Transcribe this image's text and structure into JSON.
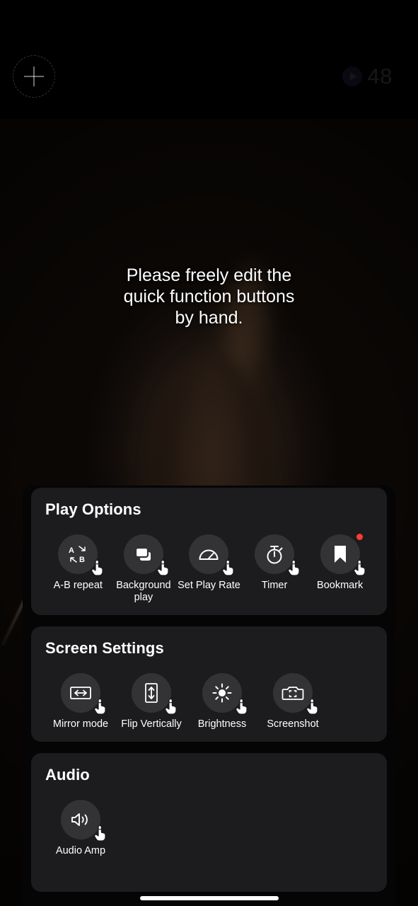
{
  "topbar": {
    "add_button_icon": "plus-icon",
    "play_count_icon": "play-circle-icon",
    "play_count": "48"
  },
  "hint": {
    "line1": "Please freely edit the",
    "line2": "quick function buttons",
    "line3": "by hand."
  },
  "colors": {
    "card_background": "#1c1c1e",
    "circle_background": "#333335",
    "badge_red": "#ff3b30",
    "text": "#ffffff"
  },
  "sections": [
    {
      "title": "Play Options",
      "buttons": [
        {
          "label": "A-B repeat",
          "icon": "ab-repeat-icon",
          "badge": false
        },
        {
          "label": "Background play",
          "icon": "background-play-icon",
          "badge": false
        },
        {
          "label": "Set Play Rate",
          "icon": "speed-gauge-icon",
          "badge": false
        },
        {
          "label": "Timer",
          "icon": "stopwatch-icon",
          "badge": false
        },
        {
          "label": "Bookmark",
          "icon": "bookmark-icon",
          "badge": true
        }
      ]
    },
    {
      "title": "Screen Settings",
      "buttons": [
        {
          "label": "Mirror mode",
          "icon": "mirror-horizontal-icon",
          "badge": false
        },
        {
          "label": "Flip Vertically",
          "icon": "flip-vertical-icon",
          "badge": false
        },
        {
          "label": "Brightness",
          "icon": "sun-icon",
          "badge": false
        },
        {
          "label": "Screenshot",
          "icon": "camera-icon",
          "badge": false
        }
      ]
    },
    {
      "title": "Audio",
      "buttons": [
        {
          "label": "Audio Amp",
          "icon": "speaker-wave-icon",
          "badge": false
        }
      ]
    }
  ],
  "tap_hand_icon": "tap-hand-icon",
  "home_indicator": "home-indicator"
}
